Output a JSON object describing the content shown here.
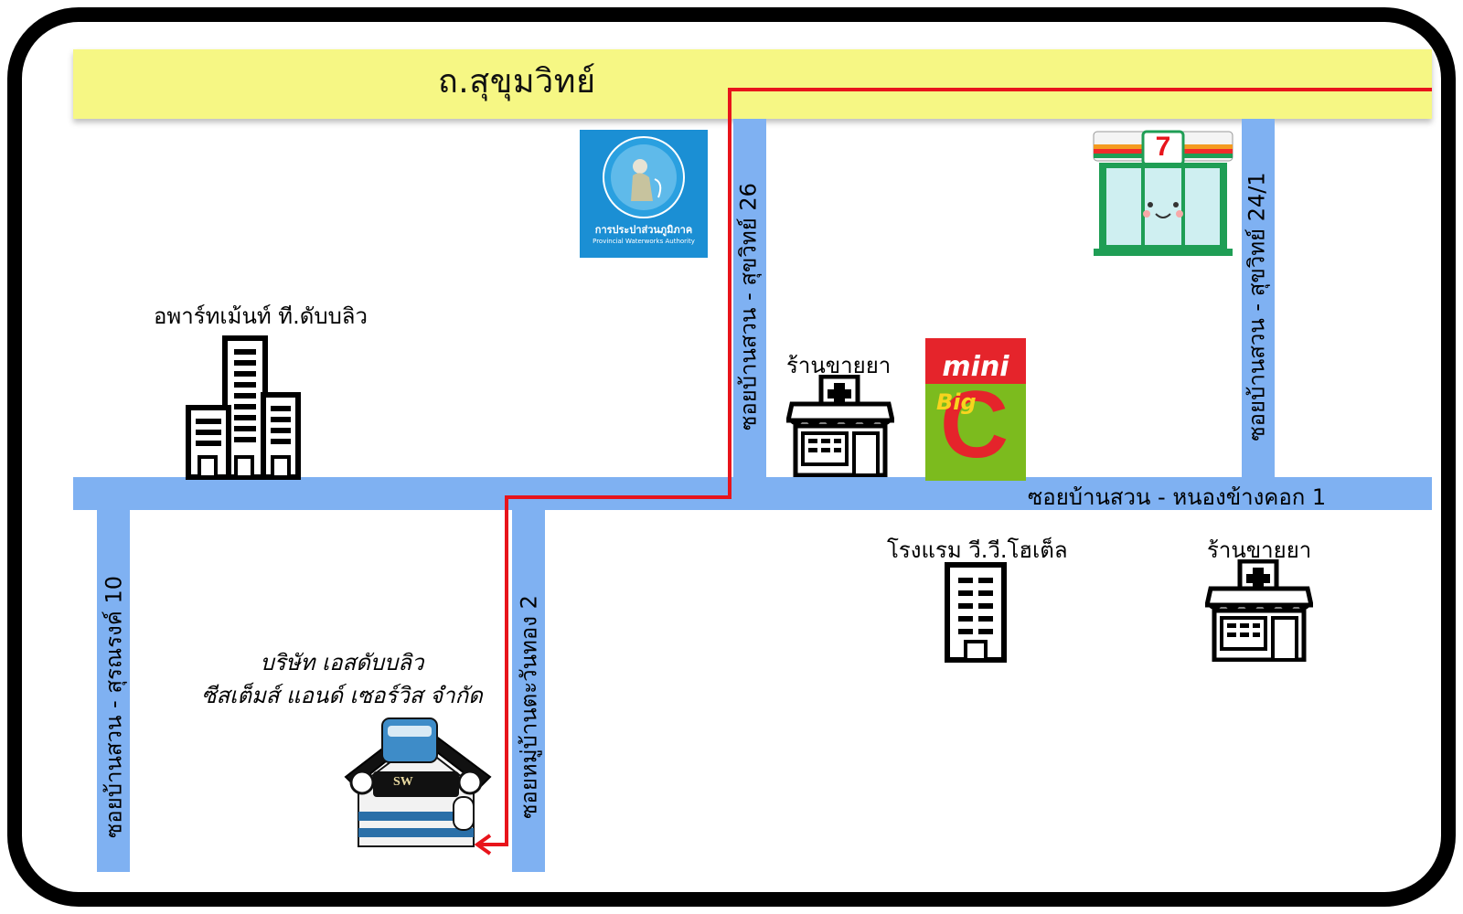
{
  "roads": {
    "main": "ถ.สุขุมวิทย์",
    "soi26": "ซอยบ้านสวน - สุขวิทย์ 26",
    "soi24_1": "ซอยบ้านสวน - สุขวิทย์ 24/1",
    "horizontal": "ซอยบ้านสวน - หนองข้างคอก 1",
    "surarong10": "ซอยบ้านสวน - สุรณรงค์ 10",
    "tawanthong2": "ซอยหมู่บ้านตะวันทอง 2"
  },
  "places": {
    "apartment": "อพาร์ทเม้นท์ ที.ดับบลิว",
    "pharmacy_top": "ร้านขายยา",
    "hotel": "โรงแรม วี.วี.โฮเต็ล",
    "pharmacy_bottom": "ร้านขายยา",
    "company_line1": "บริษัท เอสดับบลิว",
    "company_line2": "ซีสเต็มส์ แอนด์ เซอร์วิส จำกัด"
  },
  "logos": {
    "pwa_th": "การประปาส่วนภูมิภาค",
    "pwa_en": "Provincial Waterworks Authority",
    "minibigc_mini": "mini",
    "minibigc_big": "Big",
    "minibigc_c": "C",
    "seven": "7",
    "sw": "SW"
  },
  "colors": {
    "main_road": "#f6f784",
    "side_road": "#7fb1f2",
    "route": "#e8141b",
    "frame": "#000000"
  }
}
